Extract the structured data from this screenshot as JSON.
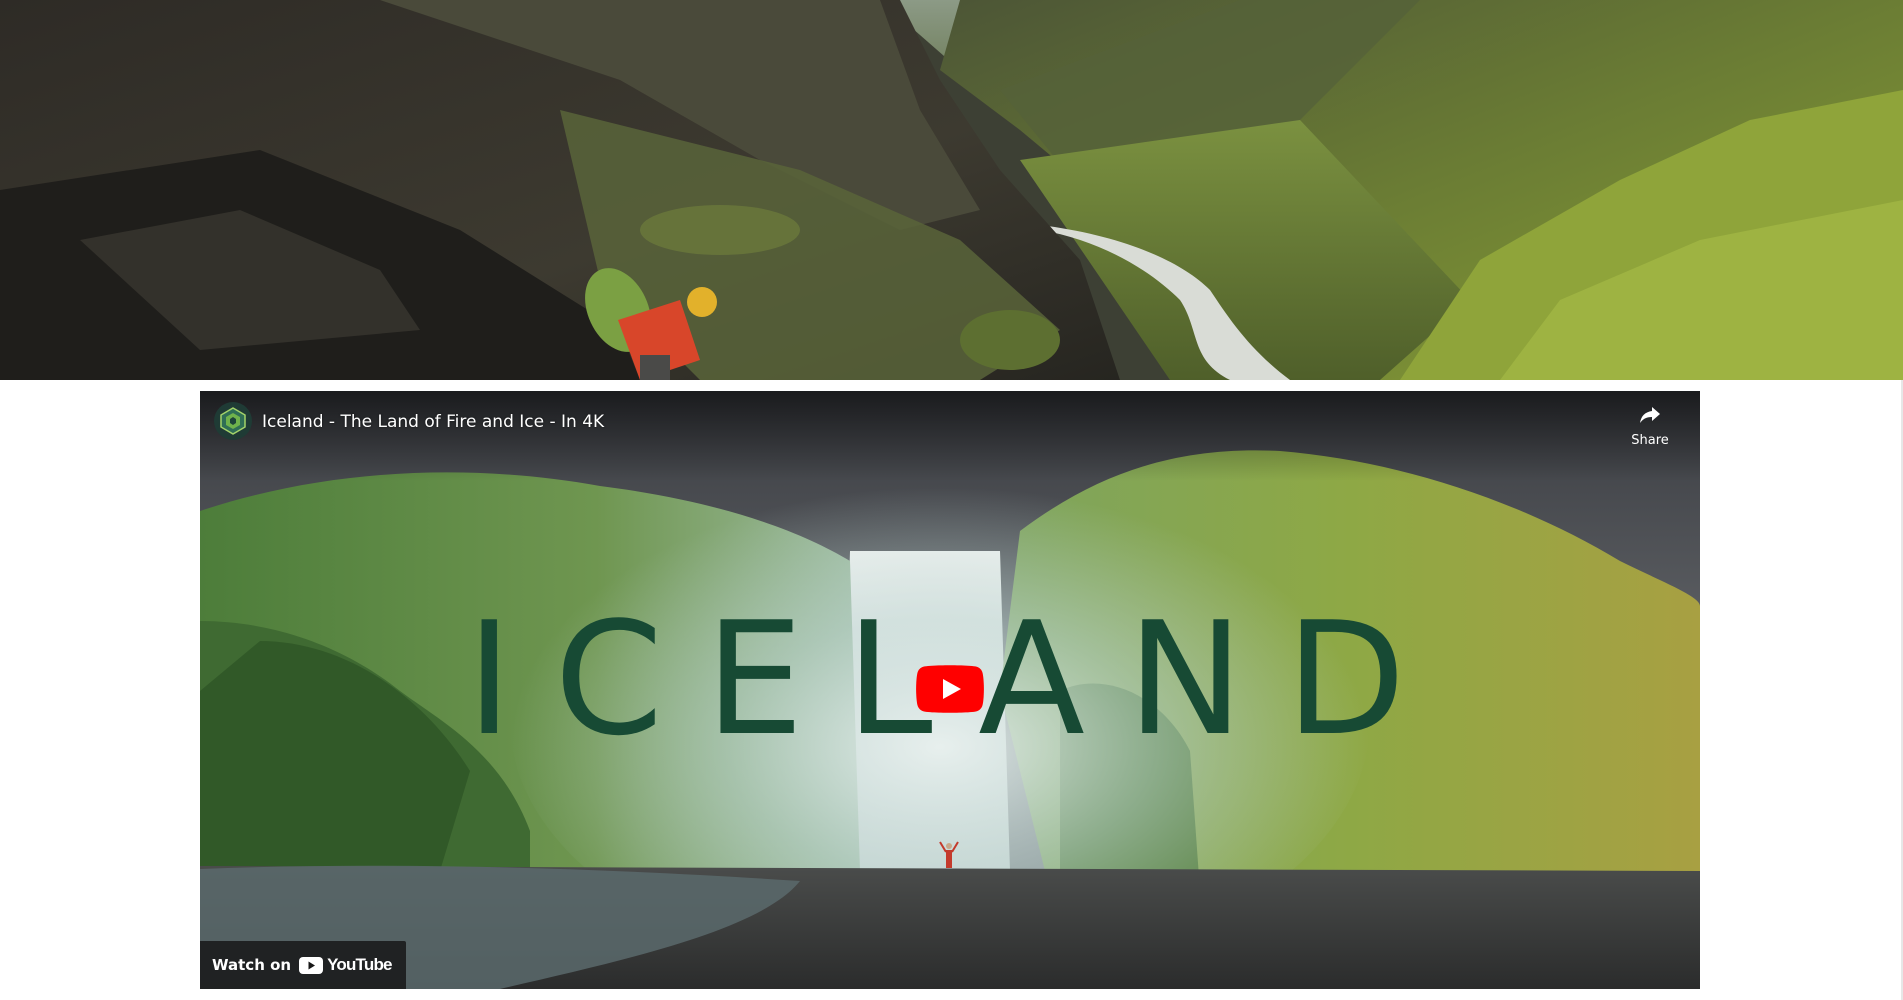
{
  "hero": {
    "scene": "mountain-valley-hiker"
  },
  "video": {
    "title": "Iceland - The Land of Fire and Ice - In 4K",
    "channel_icon": "hexagon-logo-icon",
    "share_label": "Share",
    "overlay_word": "ICELAND",
    "watch_on_label": "Watch on",
    "platform_name": "YouTube"
  },
  "colors": {
    "overlay_word": "#174a34",
    "play_button": "#ff0000",
    "youtube_red": "#ff0000",
    "page_background": "#ffffff"
  }
}
